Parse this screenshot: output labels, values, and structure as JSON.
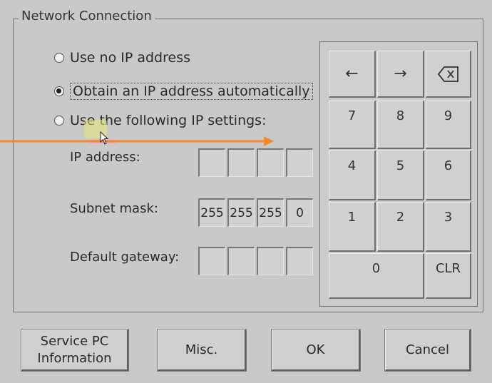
{
  "window": {
    "group_title": "Network Connection"
  },
  "ip_options": [
    {
      "label": "Use no IP address",
      "selected": false
    },
    {
      "label": "Obtain an IP address automatically",
      "selected": true
    },
    {
      "label": "Use the following IP settings:",
      "selected": false
    }
  ],
  "fields": {
    "ip_address": {
      "label": "IP address:",
      "octets": [
        "",
        "",
        "",
        ""
      ]
    },
    "subnet_mask": {
      "label": "Subnet mask:",
      "octets": [
        "255",
        "255",
        "255",
        "0"
      ]
    },
    "default_gateway": {
      "label": "Default gateway:",
      "octets": [
        "",
        "",
        "",
        ""
      ]
    }
  },
  "keypad": {
    "left_arrow": "←",
    "right_arrow": "→",
    "backspace_icon": "backspace-icon",
    "digits": [
      "7",
      "8",
      "9",
      "4",
      "5",
      "6",
      "1",
      "2",
      "3",
      "0"
    ],
    "clear": "CLR"
  },
  "buttons": {
    "service_pc_line1": "Service PC",
    "service_pc_line2": "Information",
    "misc": "Misc.",
    "ok": "OK",
    "cancel": "Cancel"
  },
  "colors": {
    "annotation_arrow": "#f08a32",
    "highlight": "#e6e678",
    "window_bg": "#c9c9c7"
  }
}
